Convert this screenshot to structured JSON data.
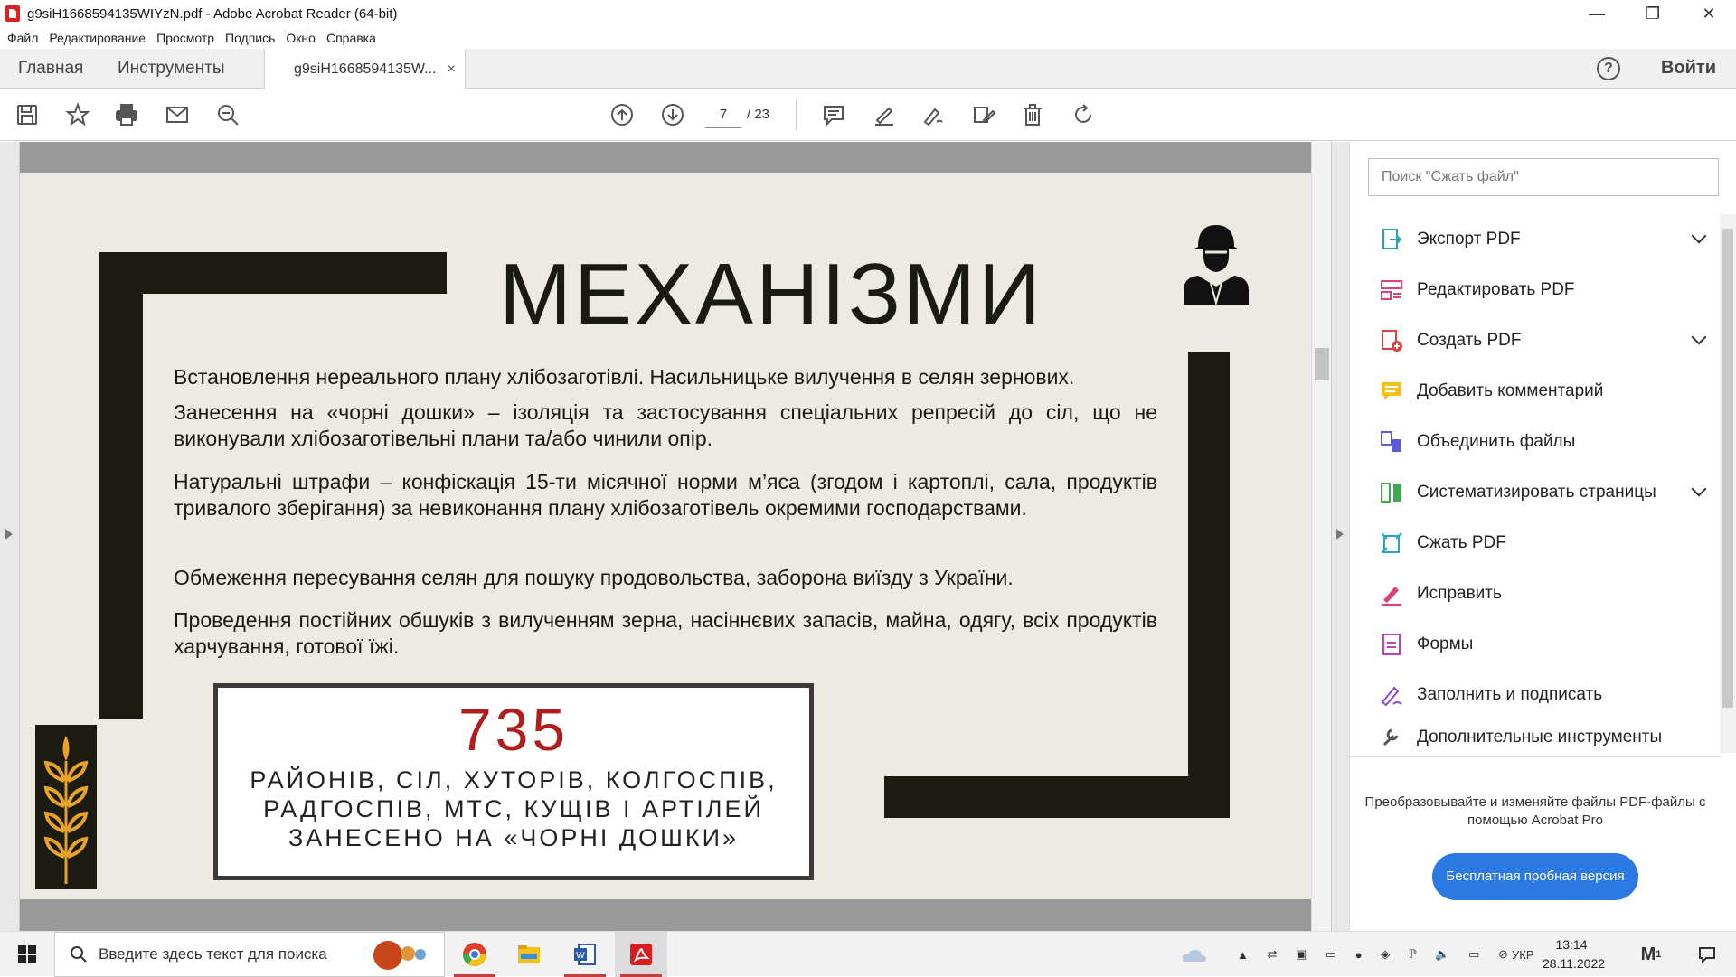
{
  "window": {
    "title": "g9siH1668594135WIYzN.pdf - Adobe Acrobat Reader (64-bit)"
  },
  "menu": [
    "Файл",
    "Редактирование",
    "Просмотр",
    "Подпись",
    "Окно",
    "Справка"
  ],
  "tabs": {
    "home": "Главная",
    "tools": "Инструменты",
    "document": "g9siH1668594135W...",
    "close": "×"
  },
  "header": {
    "signin": "Войти",
    "help": "?"
  },
  "toolbar": {
    "current_page": "7",
    "total_pages": "/ 23"
  },
  "slide": {
    "title": "МЕХАНІЗМИ",
    "paragraphs": [
      "Встановлення нереального плану хлібозаготівлі. Насильницьке вилучення в селян зернових.",
      "Занесення на «чорні дошки» – ізоляція та застосування спеціальних репресій до сіл, що не виконували хлібозаготівельні плани та/або чинили опір.",
      "Натуральні штрафи – конфіскація 15-ти місячної норми м’яса (згодом і картоплі, сала, продуктів тривалого зберігання) за невиконання плану хлібозаготівель окремими господарствами.",
      "Обмеження пересування селян для пошуку продовольства, заборона виїзду з України.",
      "Проведення постійних обшуків з вилученням зерна, насіннєвих запасів, майна, одягу, всіх продуктів харчування, готової їжі."
    ],
    "stat_number": "735",
    "stat_line1": "РАЙОНІВ, СІЛ, ХУТОРІВ,  КОЛГОСПІВ,",
    "stat_line2": "РАДГОСПІВ, МТС, КУЩІВ І АРТІЛЕЙ",
    "stat_line3": "ЗАНЕСЕНО НА «ЧОРНІ ДОШКИ»",
    "accent_color": "#b01e1e"
  },
  "tools_pane": {
    "search_placeholder": "Поиск \"Сжать файл\"",
    "items": [
      {
        "label": "Экспорт PDF",
        "icon": "export-pdf-icon"
      },
      {
        "label": "Редактировать PDF",
        "icon": "edit-pdf-icon"
      },
      {
        "label": "Создать PDF",
        "icon": "create-pdf-icon"
      },
      {
        "label": "Добавить комментарий",
        "icon": "comment-icon"
      },
      {
        "label": "Объединить файлы",
        "icon": "combine-files-icon"
      },
      {
        "label": "Систематизировать страницы",
        "icon": "organize-pages-icon"
      },
      {
        "label": "Сжать PDF",
        "icon": "compress-pdf-icon"
      },
      {
        "label": "Исправить",
        "icon": "redact-icon"
      },
      {
        "label": "Формы",
        "icon": "forms-icon"
      },
      {
        "label": "Заполнить и подписать",
        "icon": "fill-sign-icon"
      },
      {
        "label": "Дополнительные инструменты",
        "icon": "more-tools-icon"
      }
    ],
    "promo_text": "Преобразовывайте и изменяйте файлы PDF-файлы с помощью Acrobat Pro",
    "trial_button": "Бесплатная пробная версия"
  },
  "taskbar": {
    "search_placeholder": "Введите здесь текст для поиска",
    "language": "УКР",
    "time": "13:14",
    "date": "28.11.2022",
    "notification_count": "1"
  }
}
